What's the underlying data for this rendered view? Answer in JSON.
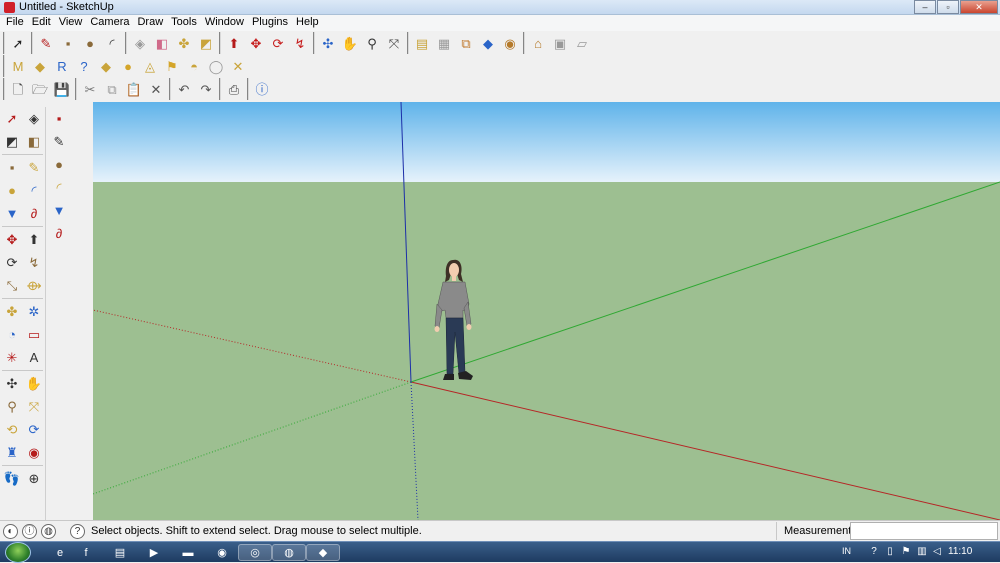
{
  "window": {
    "title": "Untitled - SketchUp"
  },
  "menu": [
    "File",
    "Edit",
    "View",
    "Camera",
    "Draw",
    "Tools",
    "Window",
    "Plugins",
    "Help"
  ],
  "toolbar1": [
    {
      "name": "select-tool-icon",
      "glyph": "➚"
    },
    {
      "name": "line-tool-icon",
      "glyph": "✎"
    },
    {
      "name": "rectangle-tool-icon",
      "glyph": "▪"
    },
    {
      "name": "circle-tool-icon",
      "glyph": "●"
    },
    {
      "name": "arc-tool-icon",
      "glyph": "◜"
    },
    {
      "name": "make-component-icon",
      "glyph": "◈"
    },
    {
      "name": "eraser-tool-icon",
      "glyph": "◧"
    },
    {
      "name": "tape-measure-icon",
      "glyph": "✤"
    },
    {
      "name": "paint-bucket-icon",
      "glyph": "◩"
    },
    {
      "name": "push-pull-icon",
      "glyph": "⬆"
    },
    {
      "name": "move-tool-icon",
      "glyph": "✥"
    },
    {
      "name": "rotate-tool-icon",
      "glyph": "⟳"
    },
    {
      "name": "follow-me-icon",
      "glyph": "↯"
    },
    {
      "name": "orbit-tool-icon",
      "glyph": "✣"
    },
    {
      "name": "pan-tool-icon",
      "glyph": "✋"
    },
    {
      "name": "zoom-tool-icon",
      "glyph": "⚲"
    },
    {
      "name": "zoom-extents-icon",
      "glyph": "⤧"
    },
    {
      "name": "get-models-icon",
      "glyph": "▤"
    },
    {
      "name": "share-model-icon",
      "glyph": "▦"
    },
    {
      "name": "components-icon",
      "glyph": "⧉"
    },
    {
      "name": "extension-warehouse-icon",
      "glyph": "◆"
    },
    {
      "name": "get-current-view-icon",
      "glyph": "◉"
    },
    {
      "name": "add-building-icon",
      "glyph": "⌂"
    },
    {
      "name": "photo-textures-icon",
      "glyph": "▣"
    },
    {
      "name": "toggle-terrain-icon",
      "glyph": "▱"
    }
  ],
  "toolbar2": [
    {
      "name": "m-badge-icon",
      "glyph": "M"
    },
    {
      "name": "tag-icon",
      "glyph": "◆"
    },
    {
      "name": "r-badge-icon",
      "glyph": "R"
    },
    {
      "name": "help-badge-icon",
      "glyph": "?"
    },
    {
      "name": "dynamic-component-icon",
      "glyph": "◆"
    },
    {
      "name": "sphere-icon",
      "glyph": "●"
    },
    {
      "name": "sandbox-icon",
      "glyph": "◬"
    },
    {
      "name": "flag-icon",
      "glyph": "⚑"
    },
    {
      "name": "shadow-icon",
      "glyph": "◓"
    },
    {
      "name": "globe-gray-icon",
      "glyph": "◯"
    },
    {
      "name": "x-axis-icon",
      "glyph": "✕"
    }
  ],
  "toolbar3": [
    {
      "name": "new-file-icon",
      "glyph": "🗋"
    },
    {
      "name": "open-file-icon",
      "glyph": "🗁"
    },
    {
      "name": "save-file-icon",
      "glyph": "💾"
    },
    {
      "name": "cut-icon",
      "glyph": "✂"
    },
    {
      "name": "copy-icon",
      "glyph": "⧉"
    },
    {
      "name": "paste-icon",
      "glyph": "📋"
    },
    {
      "name": "delete-icon",
      "glyph": "✕"
    },
    {
      "name": "undo-icon",
      "glyph": "↶"
    },
    {
      "name": "redo-icon",
      "glyph": "↷"
    },
    {
      "name": "print-icon",
      "glyph": "⎙"
    },
    {
      "name": "model-info-icon",
      "glyph": "ⓘ"
    }
  ],
  "lefttools_a": [
    {
      "name": "select-icon",
      "glyph": "➚"
    },
    {
      "name": "paint-icon",
      "glyph": "◩"
    },
    {
      "name": "rectangle-icon",
      "glyph": "▪"
    },
    {
      "name": "circle-icon",
      "glyph": "●"
    },
    {
      "name": "polygon-icon",
      "glyph": "▼"
    },
    {
      "name": "move-icon",
      "glyph": "✥"
    },
    {
      "name": "rotate-icon",
      "glyph": "⟳"
    },
    {
      "name": "scale-icon",
      "glyph": "⤡"
    },
    {
      "name": "tape-icon",
      "glyph": "✤"
    },
    {
      "name": "protractor-icon",
      "glyph": "◔"
    },
    {
      "name": "axes-icon",
      "glyph": "✳"
    },
    {
      "name": "orbit-icon",
      "glyph": "✣"
    },
    {
      "name": "zoom-icon",
      "glyph": "⚲"
    },
    {
      "name": "previous-view-icon",
      "glyph": "⟲"
    },
    {
      "name": "position-camera-icon",
      "glyph": "♜"
    },
    {
      "name": "walk-icon",
      "glyph": "👣"
    }
  ],
  "lefttools_a2": [
    {
      "name": "component-icon",
      "glyph": "◈"
    },
    {
      "name": "eraser-icon",
      "glyph": "◧"
    },
    {
      "name": "line-icon",
      "glyph": "✎"
    },
    {
      "name": "arc-icon",
      "glyph": "◜"
    },
    {
      "name": "freehand-icon",
      "glyph": "∂"
    },
    {
      "name": "pushpull-icon",
      "glyph": "⬆"
    },
    {
      "name": "followme-icon",
      "glyph": "↯"
    },
    {
      "name": "offset-icon",
      "glyph": "⟴"
    },
    {
      "name": "dimension-icon",
      "glyph": "✲"
    },
    {
      "name": "text-icon",
      "glyph": "▭"
    },
    {
      "name": "3d-text-icon",
      "glyph": "A"
    },
    {
      "name": "pan-icon",
      "glyph": "✋"
    },
    {
      "name": "zoom-window-icon",
      "glyph": "⤧"
    },
    {
      "name": "next-view-icon",
      "glyph": "⟳"
    },
    {
      "name": "look-around-icon",
      "glyph": "◉"
    },
    {
      "name": "section-plane-icon",
      "glyph": "⊕"
    }
  ],
  "lefttools_b": [
    {
      "name": "rectangle-b-icon",
      "glyph": "▪"
    },
    {
      "name": "line-b-icon",
      "glyph": "✎"
    },
    {
      "name": "circle-b-icon",
      "glyph": "●"
    },
    {
      "name": "arc-b-icon",
      "glyph": "◜"
    },
    {
      "name": "polygon-b-icon",
      "glyph": "▼"
    },
    {
      "name": "freehand-b-icon",
      "glyph": "∂"
    }
  ],
  "status": {
    "message": "Select objects. Shift to extend select. Drag mouse to select multiple.",
    "measurements_label": "Measurements",
    "measurements_value": ""
  },
  "taskbar": {
    "apps": [
      {
        "name": "ie-icon",
        "glyph": "e"
      },
      {
        "name": "facebook-icon",
        "glyph": "f"
      },
      {
        "name": "file-icon",
        "glyph": "▤"
      },
      {
        "name": "media-player-icon",
        "glyph": "▶"
      },
      {
        "name": "folder-icon",
        "glyph": "▬"
      },
      {
        "name": "firefox-icon",
        "glyph": "◉"
      },
      {
        "name": "chrome-icon",
        "glyph": "◎"
      },
      {
        "name": "app-icon",
        "glyph": "◍"
      },
      {
        "name": "sketchup-icon",
        "glyph": "◆"
      }
    ],
    "language": "IN",
    "clock": "11:10"
  },
  "colors": {
    "sky_top": "#5fb3ea",
    "sky_bottom": "#e6f2fb",
    "ground": "#9dbf91",
    "axis_red": "#b52626",
    "axis_green": "#2fa832",
    "axis_blue": "#1c2fa8"
  }
}
